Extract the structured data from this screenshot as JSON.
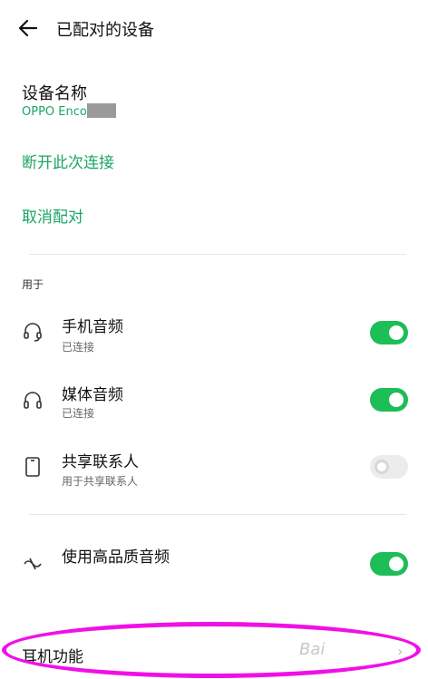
{
  "header": {
    "title": "已配对的设备",
    "back_icon": "arrow-left-icon"
  },
  "device": {
    "name_label": "设备名称",
    "name_value": "OPPO Enco"
  },
  "actions": {
    "disconnect": "断开此次连接",
    "unpair": "取消配对"
  },
  "section": {
    "label": "用于"
  },
  "profiles": [
    {
      "title": "手机音频",
      "subtitle": "已连接",
      "icon": "headset-icon",
      "enabled": true
    },
    {
      "title": "媒体音频",
      "subtitle": "已连接",
      "icon": "headphones-icon",
      "enabled": true
    },
    {
      "title": "共享联系人",
      "subtitle": "用于共享联系人",
      "icon": "phone-icon",
      "enabled": false
    }
  ],
  "hq_audio": {
    "title": "使用高品质音频",
    "icon": "hd-audio-icon",
    "enabled": true
  },
  "earphone_functions": {
    "label": "耳机功能"
  },
  "watermark": "Bai",
  "colors": {
    "accent": "#1aa564",
    "toggle_on": "#1dbd57",
    "highlight": "#f010e6"
  }
}
